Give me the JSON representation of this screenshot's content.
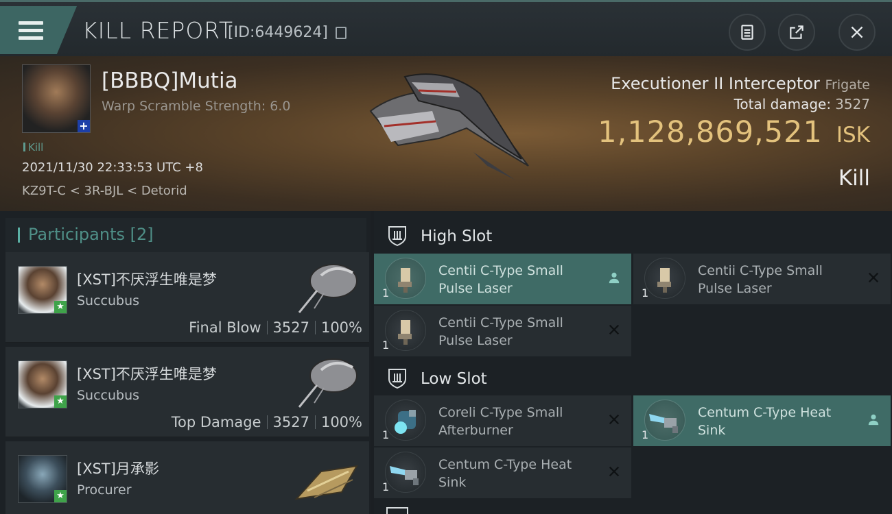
{
  "header": {
    "title": "KILL REPORT",
    "report_id": "[ID:6449624]"
  },
  "victim": {
    "name": "[BBBQ]Mutia",
    "warp_scramble": "Warp Scramble Strength: 6.0",
    "tag": "Kill",
    "datetime": "2021/11/30 22:33:53 UTC +8",
    "location": "KZ9T-C < 3R-BJL < Detorid"
  },
  "ship": {
    "name": "Executioner II Interceptor",
    "class": "Frigate",
    "damage_label": "Total damage:",
    "damage_value": "3527",
    "isk_value": "1,128,869,521",
    "isk_unit": "ISK",
    "result": "Kill"
  },
  "participants": {
    "title": "Participants [2]",
    "items": [
      {
        "name": "[XST]不厌浮生唯是梦",
        "ship": "Succubus",
        "role": "Final Blow",
        "damage": "3527",
        "percent": "100%"
      },
      {
        "name": "[XST]不厌浮生唯是梦",
        "ship": "Succubus",
        "role": "Top Damage",
        "damage": "3527",
        "percent": "100%"
      },
      {
        "name": "[XST]月承影",
        "ship": "Procurer"
      }
    ]
  },
  "slots": {
    "high": {
      "title": "High Slot",
      "modules": [
        {
          "name": "Centii C-Type Small Pulse Laser",
          "qty": "1",
          "state": "person-icon",
          "highlighted": true
        },
        {
          "name": "Centii C-Type Small Pulse Laser",
          "qty": "1",
          "state": "destroyed-icon",
          "highlighted": false
        },
        {
          "name": "Centii C-Type Small Pulse Laser",
          "qty": "1",
          "state": "destroyed-icon",
          "highlighted": false
        }
      ]
    },
    "low": {
      "title": "Low Slot",
      "modules": [
        {
          "name": "Coreli C-Type Small Afterburner",
          "qty": "1",
          "state": "destroyed-icon",
          "highlighted": false
        },
        {
          "name": "Centum C-Type Heat Sink",
          "qty": "1",
          "state": "person-icon",
          "highlighted": true
        },
        {
          "name": "Centum C-Type Heat Sink",
          "qty": "1",
          "state": "destroyed-icon",
          "highlighted": false
        }
      ]
    }
  },
  "colors": {
    "accent_teal": "#3f6b66",
    "isk_gold": "#e3c27d",
    "corp_badge_blue": "#1d3fa8",
    "pilot_badge_green": "#3fa34a"
  }
}
